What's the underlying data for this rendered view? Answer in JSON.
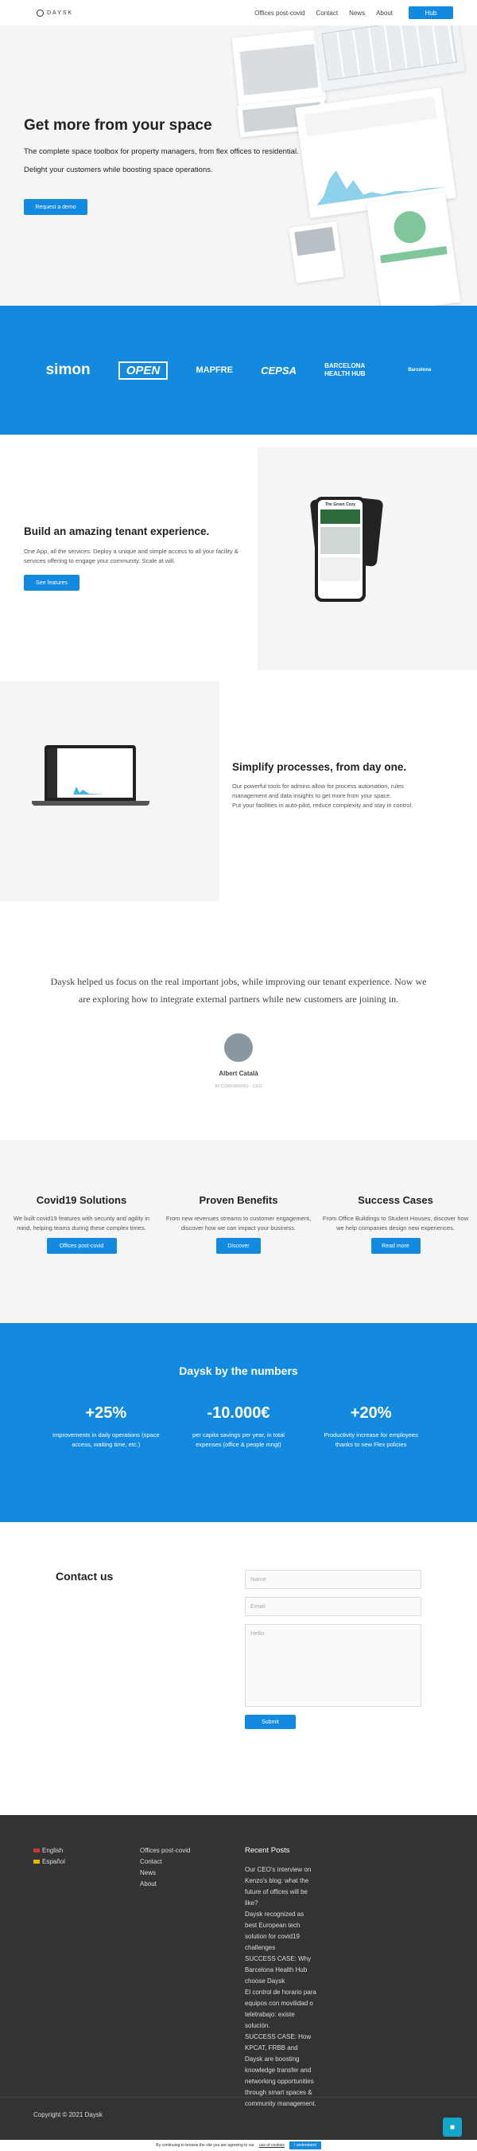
{
  "header": {
    "brand": "DAYSK",
    "nav": [
      "Offices post-covid",
      "Contact",
      "News",
      "About"
    ],
    "hub_label": "Hub"
  },
  "hero": {
    "title": "Get more from your space",
    "line1": "The complete space toolbox for property managers, from flex offices to residential.",
    "line2": "Delight your customers while boosting space operations.",
    "cta": "Request a demo"
  },
  "logos": [
    "simon",
    "OPEN",
    "MAPFRE",
    "CEPSA",
    "BARCELONA HEALTH HUB",
    "Barcelona"
  ],
  "tenant": {
    "title": "Build an amazing tenant experience.",
    "text": "One App, all the services. Deploy a unique and simple access to all your facility & services offering to engage your community. Scale at will.",
    "cta": "See features",
    "phone_header": "The Green Cozy"
  },
  "simplify": {
    "title": "Simplify processes, from day one.",
    "text1": "Our powerful tools for admins allow for process automation, rules management and data insights to get more from your space.",
    "text2": "Put your facilities in auto-pilot, reduce complexity and stay in control."
  },
  "testimonial": {
    "quote": "Daysk helped us focus on the real important jobs, while improving our tenant experience. Now we are exploring how to integrate external partners while new customers are joining in.",
    "name": "Albert Català",
    "role": "IN COWORKING - CEO"
  },
  "columns": [
    {
      "title": "Covid19 Solutions",
      "text": "We built covid19 features with security and agility in mind, helping teams during these complex times.",
      "cta": "Offices post-covid"
    },
    {
      "title": "Proven Benefits",
      "text": "From new revenues streams to customer engagement, discover how we can impact your business.",
      "cta": "Discover"
    },
    {
      "title": "Success Cases",
      "text": "From Office Buildings to Student Houses, discover how we help companies design new experiences.",
      "cta": "Read more"
    }
  ],
  "numbers": {
    "title": "Daysk by the numbers",
    "items": [
      {
        "value": "+25%",
        "text": "Improvements in daily operations (space access, waiting time, etc.)"
      },
      {
        "value": "-10.000€",
        "text": "per capita savings per year, in total expenses (office & people mngt)"
      },
      {
        "value": "+20%",
        "text": "Productivity increase for employees thanks to new Flex policies"
      }
    ]
  },
  "contact": {
    "title": "Contact us",
    "name_placeholder": "Name",
    "email_placeholder": "Email",
    "message_placeholder": "Hello",
    "submit": "Submit"
  },
  "footer": {
    "languages": [
      "English",
      "Español"
    ],
    "links": [
      "Offices post-covid",
      "Contact",
      "News",
      "About"
    ],
    "recent_title": "Recent Posts",
    "posts": [
      "Our CEO's interview on Kenzo's blog: what the future of offices will be like?",
      "Daysk recognized as best European tech solution for covid19 challenges",
      "SUCCESS CASE: Why Barcelona Health Hub choose Daysk",
      "El control de horario para equipos con movilidad o teletrabajo: existe solución.",
      "SUCCESS CASE: How KPCAT, FRBB and Daysk are boosting knowledge transfer and networking opportunities through smart spaces & community management."
    ],
    "copyright": "Copyright © 2021 Daysk"
  },
  "cookie": {
    "text": "By continuing to browse the site you are agreeing to our",
    "link": "use of cookies",
    "ok": "I understand"
  }
}
